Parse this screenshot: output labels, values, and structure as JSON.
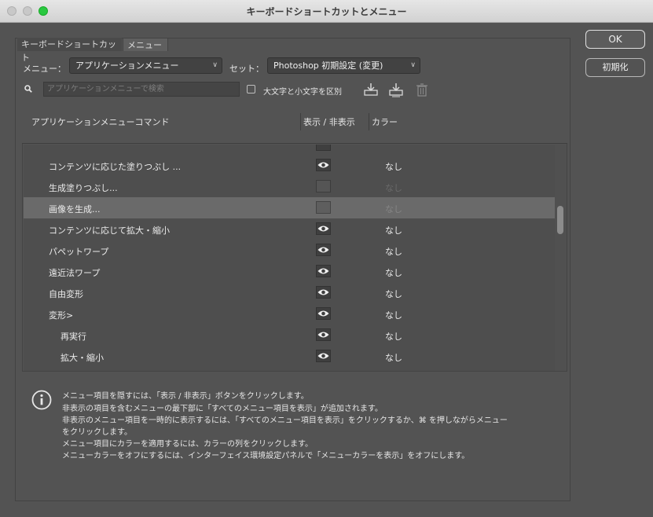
{
  "window": {
    "title": "キーボードショートカットとメニュー"
  },
  "tabs": [
    "キーボードショートカット",
    "メニュー"
  ],
  "menu_label": "メニュー：",
  "menu_select": "アプリケーションメニュー",
  "set_label": "セット：",
  "set_select": "Photoshop 初期設定 (変更)",
  "search": {
    "placeholder": "アプリケーションメニューで検索"
  },
  "case_checkbox_label": "大文字と小文字を区別",
  "columns": {
    "command": "アプリケーションメニューコマンド",
    "visibility": "表示 / 非表示",
    "color": "カラー"
  },
  "rows": [
    {
      "label": "コンテンツに応じた塗りつぶし ...",
      "visible": true,
      "color": "なし"
    },
    {
      "label": "生成塗りつぶし...",
      "visible": false,
      "color": "なし"
    },
    {
      "label": "画像を生成...",
      "visible": false,
      "color": "なし"
    },
    {
      "label": "コンテンツに応じて拡大・縮小",
      "visible": true,
      "color": "なし"
    },
    {
      "label": "パペットワープ",
      "visible": true,
      "color": "なし"
    },
    {
      "label": "遠近法ワープ",
      "visible": true,
      "color": "なし"
    },
    {
      "label": "自由変形",
      "visible": true,
      "color": "なし"
    },
    {
      "label": "変形>",
      "visible": true,
      "color": "なし"
    },
    {
      "label": "再実行",
      "visible": true,
      "color": "なし"
    },
    {
      "label": "拡大・縮小",
      "visible": true,
      "color": "なし"
    }
  ],
  "info": [
    "メニュー項目を隠すには、「表示 / 非表示」ボタンをクリックします。",
    "非表示の項目を含むメニューの最下部に「すべてのメニュー項目を表示」が追加されます。",
    "非表示のメニュー項目を一時的に表示するには、「すべてのメニュー項目を表示」をクリックするか、⌘ を押しながらメニュー",
    "をクリックします。",
    "メニュー項目にカラーを適用するには、カラーの列をクリックします。",
    "メニューカラーをオフにするには、インターフェイス環境設定パネルで「メニューカラーを表示」をオフにします。"
  ],
  "buttons": {
    "ok": "OK",
    "reset": "初期化"
  }
}
